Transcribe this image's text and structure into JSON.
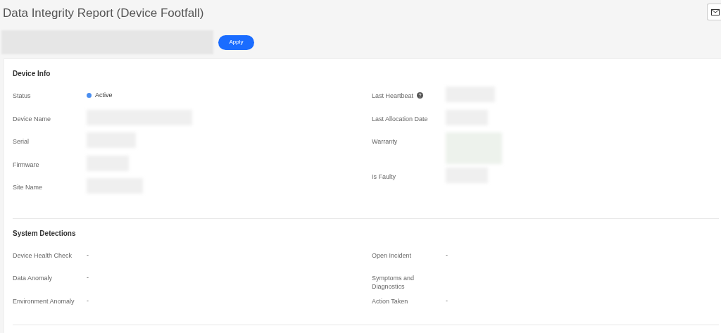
{
  "page": {
    "title": "Data Integrity Report (Device Footfall)"
  },
  "filter_bar": {
    "apply_button": "Apply"
  },
  "sections": [
    {
      "title": "Device Info",
      "left": [
        {
          "label": "Status",
          "value": "Active",
          "color": "#4a8ef0",
          "redacted": false
        },
        {
          "label": "Device Name",
          "redacted": true
        },
        {
          "label": "Serial",
          "redacted": true
        },
        {
          "label": "Firmware",
          "redacted": true
        },
        {
          "label": "Site Name",
          "redacted": true
        }
      ],
      "right": [
        {
          "label": "Last Heartbeat",
          "help": true,
          "redacted": true
        },
        {
          "label": "Last Allocation Date",
          "redacted": true
        },
        {
          "label": "Warranty",
          "redacted": true,
          "tall": true
        },
        {
          "label": "Is Faulty",
          "redacted": true
        }
      ]
    },
    {
      "title": "System Detections",
      "left": [
        {
          "label": "Device Health Check",
          "value": "-",
          "redacted": false
        },
        {
          "label": "Data Anomaly",
          "value": "-",
          "redacted": false
        },
        {
          "label": "Environment Anomaly",
          "value": "-",
          "redacted": false
        }
      ],
      "right": [
        {
          "label": "Open Incident",
          "value": "-",
          "redacted": false
        },
        {
          "label": "Symptoms and Diagnostics",
          "redacted": false
        },
        {
          "label": "Action Taken",
          "value": "-",
          "redacted": false
        }
      ]
    }
  ]
}
